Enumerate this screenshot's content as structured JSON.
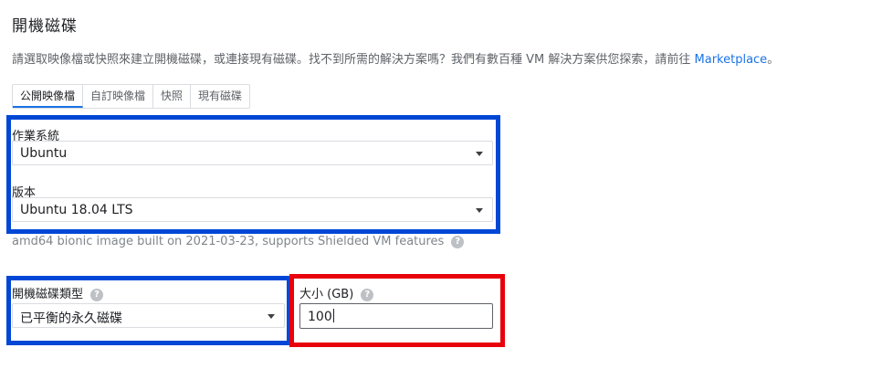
{
  "page": {
    "title": "開機磁碟",
    "description": "請選取映像檔或快照來建立開機磁碟，或連接現有磁碟。找不到所需的解決方案嗎？我們有數百種 VM 解決方案供您探索，請前往 ",
    "description_link": "Marketplace",
    "description_end": "。"
  },
  "tabs": [
    {
      "label": "公開映像檔",
      "active": true
    },
    {
      "label": "自訂映像檔",
      "active": false
    },
    {
      "label": "快照",
      "active": false
    },
    {
      "label": "現有磁碟",
      "active": false
    }
  ],
  "os": {
    "label": "作業系統",
    "value": "Ubuntu"
  },
  "version": {
    "label": "版本",
    "value": "Ubuntu 18.04 LTS",
    "hint": "amd64 bionic image built on 2021-03-23, supports Shielded VM features"
  },
  "disk_type": {
    "label": "開機磁碟類型",
    "value": "已平衡的永久磁碟"
  },
  "size": {
    "label": "大小 (GB)",
    "value": "100"
  },
  "help_glyph": "?",
  "highlights": {
    "blue": "#0047d6",
    "red": "#e8000b"
  },
  "icons": {
    "help": "help-circle-icon",
    "dropdown": "caret-down-icon"
  }
}
